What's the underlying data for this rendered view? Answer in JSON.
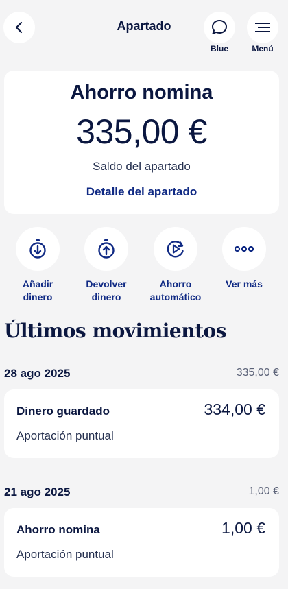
{
  "header": {
    "title": "Apartado",
    "blue_label": "Blue",
    "menu_label": "Menú"
  },
  "summary": {
    "name": "Ahorro nomina",
    "amount": "335,00 €",
    "subtitle": "Saldo del apartado",
    "detail_link": "Detalle del apartado"
  },
  "actions": [
    {
      "label": "Añadir dinero",
      "icon": "stopwatch-down-icon"
    },
    {
      "label": "Devolver dinero",
      "icon": "stopwatch-up-icon"
    },
    {
      "label": "Ahorro automático",
      "icon": "auto-play-icon"
    },
    {
      "label": "Ver más",
      "icon": "more-dots-icon"
    }
  ],
  "movements": {
    "title": "Últimos movimientos",
    "groups": [
      {
        "date": "28 ago 2025",
        "total": "335,00 €",
        "items": [
          {
            "title": "Dinero guardado",
            "amount": "334,00 €",
            "subtitle": "Aportación puntual"
          }
        ]
      },
      {
        "date": "21 ago 2025",
        "total": "1,00 €",
        "items": [
          {
            "title": "Ahorro nomina",
            "amount": "1,00 €",
            "subtitle": "Aportación puntual"
          }
        ]
      }
    ]
  },
  "colors": {
    "background": "#f4f4f5",
    "primary_text": "#0b1740",
    "link": "#102a84",
    "card": "#ffffff"
  }
}
